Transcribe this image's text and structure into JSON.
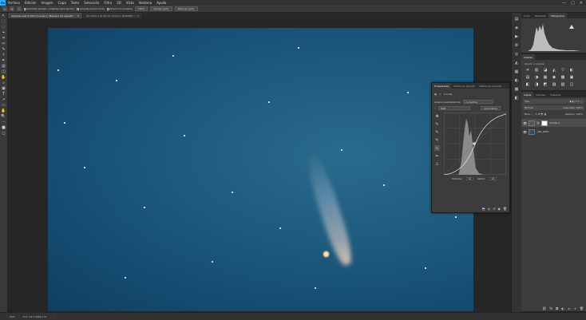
{
  "app": {
    "logo": "Ps"
  },
  "menubar": {
    "items": [
      "Archivo",
      "Edición",
      "Imagen",
      "Capa",
      "Texto",
      "Selección",
      "Filtro",
      "3D",
      "Vista",
      "Ventana",
      "Ayuda"
    ],
    "window_controls": [
      "—",
      "□",
      "✕"
    ]
  },
  "optionsbar": {
    "chk_resize": "Cambiar tamaño ventanas para ajustar",
    "chk_all": "Ampliar/reducir todo",
    "chk_scrubby": "Zoom con arrastre",
    "zoom_value": "100%",
    "fit_button": "Ajustar pant.",
    "fill_button": "Rellenar pant."
  },
  "tabs": [
    {
      "label": "Aplicado.psd al 50% (Curvas 1, Máscara de capa/8) *",
      "active": true
    },
    {
      "label": "Sin título-1 al 66,7% (Capa 1, RGB/8#) *",
      "active": false
    }
  ],
  "statusbar": {
    "zoom": "50%",
    "doc": "Doc: 93,2 M/80,1 M",
    "arrow": "›"
  },
  "histogram_panel": {
    "tabs": [
      "Color",
      "Muestras",
      "Histograma"
    ],
    "active": "Histograma"
  },
  "adjustments_panel": {
    "tabs": [
      "Ajustes"
    ],
    "label": "Añadir un ajuste",
    "icons": [
      "☀",
      "▥",
      "◪",
      "◭",
      "▽",
      "◐",
      "▤",
      "◑",
      "▦",
      "◉",
      "▩",
      "▣",
      "◧",
      "◨",
      "◩",
      "▨",
      "▧",
      "◫"
    ]
  },
  "layers_panel": {
    "tabs": [
      "Capas",
      "Canales",
      "Trazados"
    ],
    "kind": "Tipo",
    "blend": "Normal",
    "opacity_label": "Opacidad:",
    "opacity": "100%",
    "lock_label": "Bloq.:",
    "fill_label": "Relleno:",
    "fill": "100%",
    "layers": [
      {
        "name": "Curvas 1",
        "type": "adjustment",
        "selected": true
      },
      {
        "name": "_MG_0041",
        "type": "image",
        "selected": false
      }
    ],
    "footer_icons": [
      "⛓",
      "fx",
      "◘",
      "◐",
      "▭",
      "+",
      "🗑"
    ]
  },
  "properties_panel": {
    "tabs": [
      "Propiedades",
      "Estilos de párrafo",
      "Estilos de carácter"
    ],
    "header": "Curvas",
    "preset_label": "Ajuste preestablecido:",
    "preset_value": "A medida",
    "channel": "RGB",
    "auto_button": "Automático",
    "input_label": "Entrada:",
    "input_value": "96",
    "output_label": "Salida:",
    "output_value": "96",
    "curve_tools": [
      "✥",
      "✎",
      "✎",
      "✎",
      "∿",
      "✏",
      "⚠"
    ],
    "footer_icons": [
      "⬒",
      "◎",
      "↺",
      "◉",
      "🗑"
    ]
  },
  "toolbar": {
    "tools": [
      "↖",
      "⬚",
      "◌",
      "⌖",
      "⌗",
      "✂",
      "✎",
      "⚕",
      "✒",
      "▥",
      "◫",
      "✋",
      "⌕",
      "▣",
      "T",
      "↗",
      "▭",
      "✋",
      "🔍",
      "⋯",
      "■",
      "◻"
    ]
  },
  "icondock": {
    "icons": [
      "▤",
      "◈",
      "▶",
      "⚙",
      "◎",
      "◭",
      "▦",
      "◐",
      "▩",
      "◧"
    ]
  }
}
